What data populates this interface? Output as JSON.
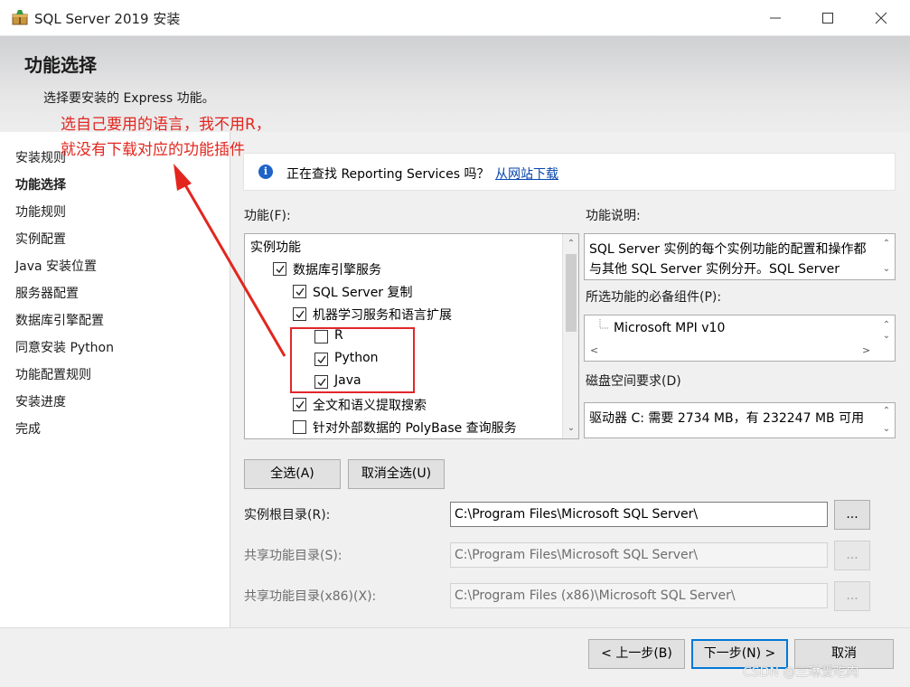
{
  "window": {
    "title": "SQL Server 2019 安装"
  },
  "header": {
    "page_title": "功能选择",
    "subtitle": "选择要安装的 Express 功能。"
  },
  "annotation": {
    "line1": "选自己要用的语言，我不用R，",
    "line2": "就没有下载对应的功能插件",
    "color": "#e2261e"
  },
  "nav": {
    "items": [
      {
        "label": "安装规则"
      },
      {
        "label": "功能选择"
      },
      {
        "label": "功能规则"
      },
      {
        "label": "实例配置"
      },
      {
        "label": "Java 安装位置"
      },
      {
        "label": "服务器配置"
      },
      {
        "label": "数据库引擎配置"
      },
      {
        "label": "同意安装 Python"
      },
      {
        "label": "功能配置规则"
      },
      {
        "label": "安装进度"
      },
      {
        "label": "完成"
      }
    ]
  },
  "infobar": {
    "text": "正在查找 Reporting Services 吗？",
    "link": "从网站下载"
  },
  "features": {
    "label": "功能(F):",
    "items": [
      {
        "label": "实例功能",
        "level": 0,
        "checkbox": false,
        "checked": false
      },
      {
        "label": "数据库引擎服务",
        "level": 1,
        "checkbox": true,
        "checked": true
      },
      {
        "label": "SQL Server 复制",
        "level": 2,
        "checkbox": true,
        "checked": true
      },
      {
        "label": "机器学习服务和语言扩展",
        "level": 2,
        "checkbox": true,
        "checked": true
      },
      {
        "label": "R",
        "level": 3,
        "checkbox": true,
        "checked": false
      },
      {
        "label": "Python",
        "level": 3,
        "checkbox": true,
        "checked": true
      },
      {
        "label": "Java",
        "level": 3,
        "checkbox": true,
        "checked": true
      },
      {
        "label": "全文和语义提取搜索",
        "level": 2,
        "checkbox": true,
        "checked": true
      },
      {
        "label": "针对外部数据的 PolyBase 查询服务",
        "level": 2,
        "checkbox": true,
        "checked": false
      }
    ]
  },
  "description": {
    "label": "功能说明:",
    "text": "SQL Server 实例的每个实例功能的配置和操作都与其他 SQL Server 实例分开。SQL Server"
  },
  "prereq": {
    "label": "所选功能的必备组件(P):",
    "item": "Microsoft MPI v10"
  },
  "disk": {
    "label": "磁盘空间要求(D)",
    "text": "驱动器 C: 需要 2734 MB，有 232247 MB 可用"
  },
  "buttons": {
    "select_all": "全选(A)",
    "deselect_all": "取消全选(U)",
    "browse": "...",
    "back": "< 上一步(B)",
    "next": "下一步(N) >",
    "cancel": "取消"
  },
  "paths": {
    "instance_root_label": "实例根目录(R):",
    "instance_root_value": "C:\\Program Files\\Microsoft SQL Server\\",
    "shared_label": "共享功能目录(S):",
    "shared_value": "C:\\Program Files\\Microsoft SQL Server\\",
    "shared_x86_label": "共享功能目录(x86)(X):",
    "shared_x86_value": "C:\\Program Files (x86)\\Microsoft SQL Server\\"
  },
  "watermark": "CSDN @三琳爱吃肉"
}
